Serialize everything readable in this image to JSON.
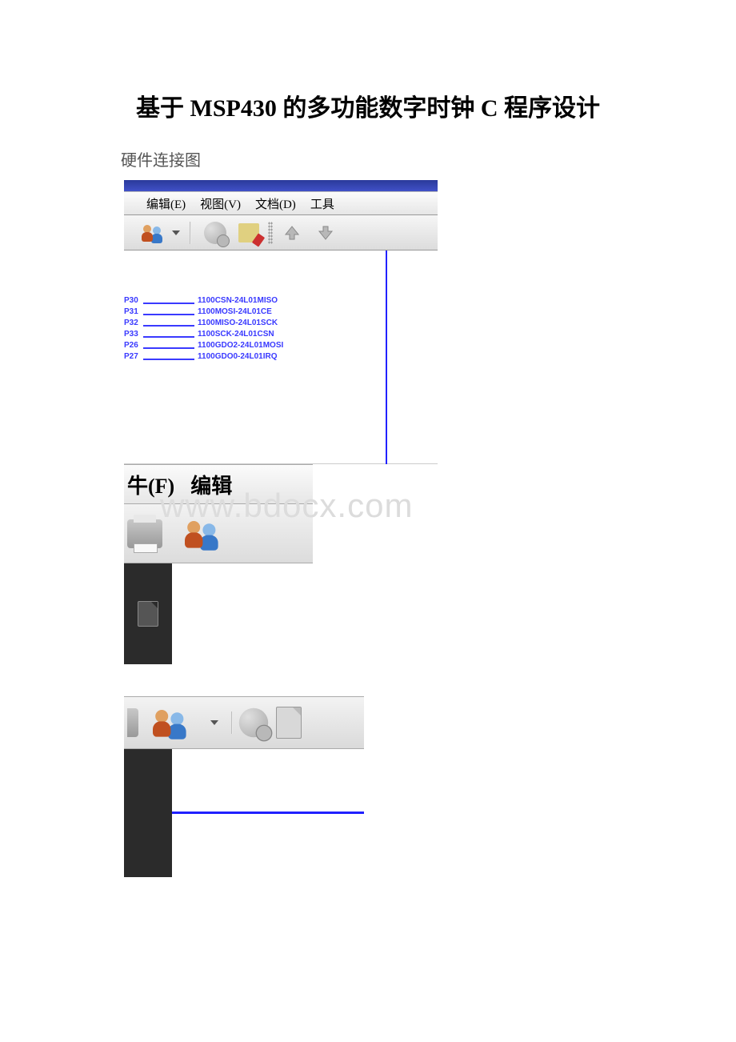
{
  "title": "基于 MSP430 的多功能数字时钟 C 程序设计",
  "subtitle": "硬件连接图",
  "watermark": "www.bdocx.com",
  "img1": {
    "menu": {
      "edit": "编辑(E)",
      "view": "视图(V)",
      "doc": "文档(D)",
      "tools": "工具"
    },
    "pins": [
      {
        "left": "P30",
        "right": "1100CSN-24L01MISO"
      },
      {
        "left": "P31",
        "right": "1100MOSI-24L01CE"
      },
      {
        "left": "P32",
        "right": "1100MISO-24L01SCK"
      },
      {
        "left": "P33",
        "right": "1100SCK-24L01CSN"
      },
      {
        "left": "P26",
        "right": "1100GDO2-24L01MOSI"
      },
      {
        "left": "P27",
        "right": "1100GDO0-24L01IRQ"
      }
    ]
  },
  "img2": {
    "menu": {
      "file": "牛(F)",
      "edit": "编辑"
    }
  }
}
